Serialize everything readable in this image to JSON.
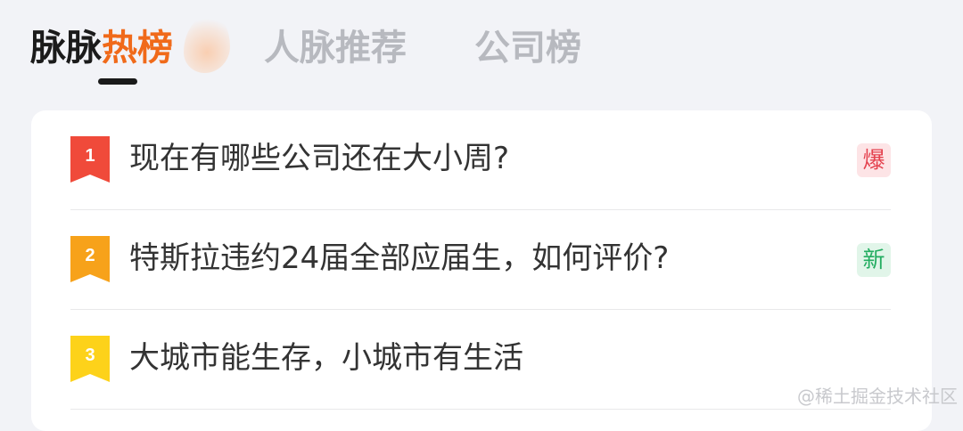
{
  "tabs": [
    {
      "label_a": "脉脉",
      "label_b": "热榜",
      "active": true
    },
    {
      "label": "人脉推荐",
      "active": false
    },
    {
      "label": "公司榜",
      "active": false
    }
  ],
  "hot_list": [
    {
      "rank": "1",
      "title": "现在有哪些公司还在大小周?",
      "badge": "爆",
      "badge_type": "hot",
      "rank_color": "#f04a3a"
    },
    {
      "rank": "2",
      "title": "特斯拉违约24届全部应届生，如何评价?",
      "badge": "新",
      "badge_type": "new",
      "rank_color": "#f7a21a"
    },
    {
      "rank": "3",
      "title": "大城市能生存，小城市有生活",
      "badge": "",
      "badge_type": "",
      "rank_color": "#fdd21a"
    }
  ],
  "watermark": "@稀土掘金技术社区",
  "colors": {
    "accent": "#f06a1a",
    "hot_badge": "#e4424f",
    "new_badge": "#23ad61"
  }
}
